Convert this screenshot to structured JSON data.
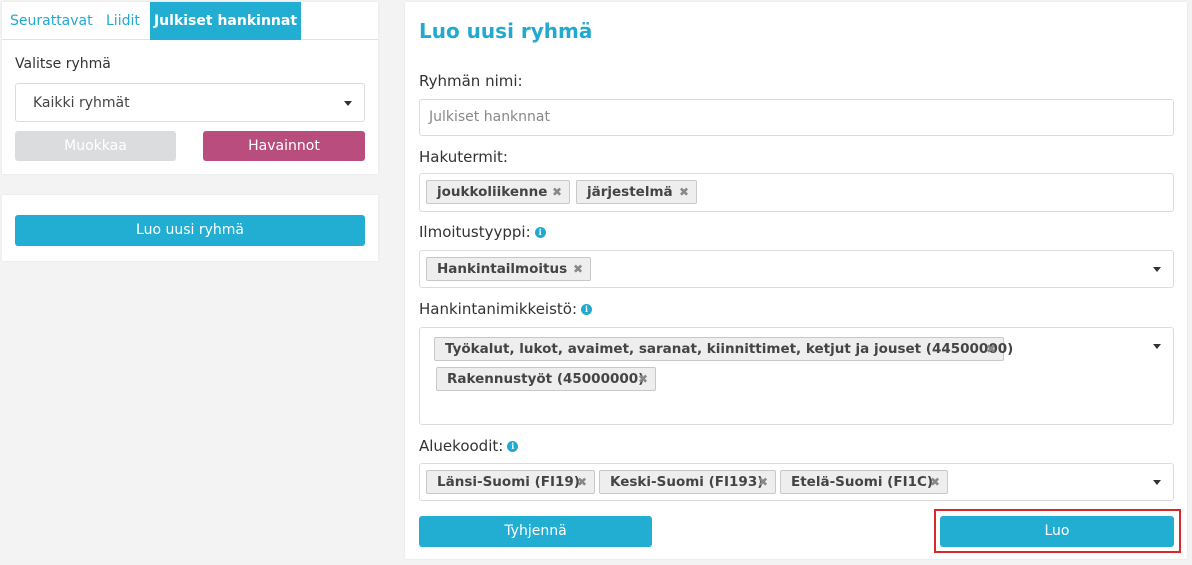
{
  "tabs": [
    {
      "label": "Seurattavat"
    },
    {
      "label": "Liidit"
    },
    {
      "label": "Julkiset hankinnat"
    }
  ],
  "group_select": {
    "label": "Valitse ryhmä",
    "value": "Kaikki ryhmät"
  },
  "buttons": {
    "edit": "Muokkaa",
    "observations": "Havainnot",
    "new_group": "Luo uusi ryhmä",
    "clear": "Tyhjennä",
    "create": "Luo"
  },
  "form": {
    "title": "Luo uusi ryhmä",
    "name": {
      "label": "Ryhmän nimi:",
      "value": "Julkiset hanknnat"
    },
    "terms": {
      "label": "Hakutermit:",
      "tags": [
        "joukkoliikenne",
        "järjestelmä"
      ]
    },
    "notice_type": {
      "label": "Ilmoitustyyppi:",
      "tags": [
        "Hankintailmoitus"
      ]
    },
    "cpv": {
      "label": "Hankintanimikkeistö:",
      "tags": [
        "Työkalut, lukot, avaimet, saranat, kiinnittimet, ketjut ja jouset (44500000)",
        "Rakennustyöt (45000000)"
      ]
    },
    "regions": {
      "label": "Aluekoodit:",
      "tags": [
        "Länsi-Suomi (FI19)",
        "Keski-Suomi (FI193)",
        "Etelä-Suomi (FI1C)"
      ]
    }
  },
  "icons": {
    "info": "info-icon",
    "remove": "remove-icon",
    "dropdown": "caret-down-icon"
  },
  "colors": {
    "accent": "#22aed3",
    "observations": "#b84d7e",
    "disabled": "#dadcde",
    "highlight": "#d9282b"
  }
}
